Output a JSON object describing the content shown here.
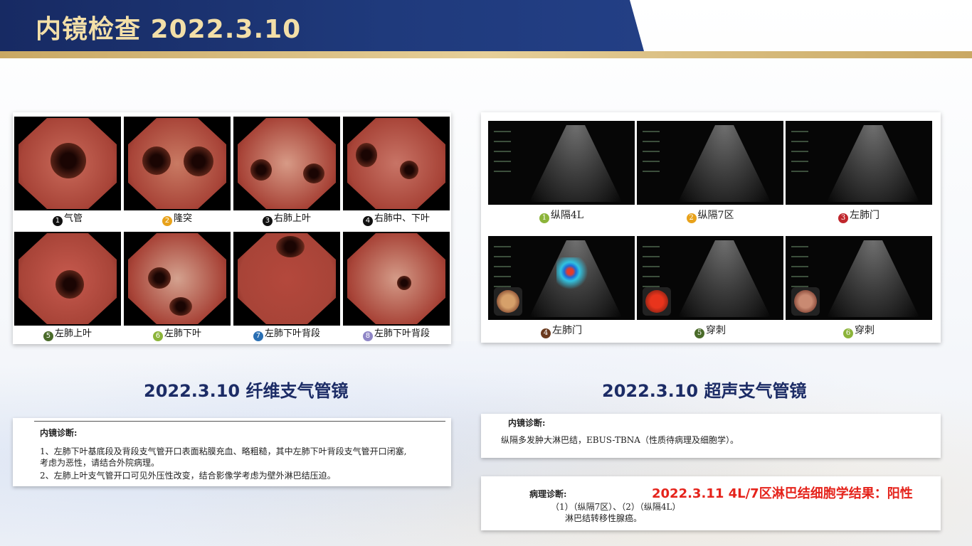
{
  "header": {
    "title": "内镜检查  2022.3.10"
  },
  "colors": {
    "header_blue": "#1f3a7c",
    "title_gold": "#f3dfa8",
    "result_red": "#e5231b",
    "caption_navy": "#1c2c66"
  },
  "bronchoscopy": {
    "caption": "2022.3.10 纤维支气管镜",
    "images": [
      {
        "num": "1",
        "label": "气管",
        "num_color": "#111111"
      },
      {
        "num": "2",
        "label": "隆突",
        "num_color": "#e8a21b"
      },
      {
        "num": "3",
        "label": "右肺上叶",
        "num_color": "#111111"
      },
      {
        "num": "4",
        "label": "右肺中、下叶",
        "num_color": "#111111"
      },
      {
        "num": "5",
        "label": "左肺上叶",
        "num_color": "#4a6b2a"
      },
      {
        "num": "6",
        "label": "左肺下叶",
        "num_color": "#8cb43a"
      },
      {
        "num": "7",
        "label": "左肺下叶背段",
        "num_color": "#2a6fb3"
      },
      {
        "num": "8",
        "label": "左肺下叶背段",
        "num_color": "#8f86c6"
      }
    ],
    "report": {
      "heading": "内镜诊断:",
      "lines": [
        "1、左肺下叶基底段及背段支气管开口表面粘膜充血、略粗糙，其中左肺下叶背段支气管开口闭塞,",
        "考虑为恶性，请结合外院病理。",
        "2、左肺上叶支气管开口可见外压性改变，结合影像学考虑为壁外淋巴结压迫。"
      ]
    }
  },
  "ebus": {
    "caption": "2022.3.10 超声支气管镜",
    "images": [
      {
        "num": "1",
        "label": "纵隔4L",
        "num_color": "#8cb43a"
      },
      {
        "num": "2",
        "label": "纵隔7区",
        "num_color": "#e8a21b"
      },
      {
        "num": "3",
        "label": "左肺门",
        "num_color": "#c0272d"
      },
      {
        "num": "4",
        "label": "左肺门",
        "num_color": "#6b3a1e"
      },
      {
        "num": "5",
        "label": "穿刺",
        "num_color": "#4a6b2a"
      },
      {
        "num": "6",
        "label": "穿刺",
        "num_color": "#8cb43a"
      }
    ],
    "report": {
      "heading": "内镜诊断:",
      "line": "纵隔多发肿大淋巴结，EBUS-TBNA（性质待病理及细胞学）。"
    },
    "pathology": {
      "heading": "病理诊断:",
      "line1": "（1）（纵隔7区）、（2）（纵隔4L）",
      "line2": "淋巴结转移性腺癌。",
      "result": "2022.3.11 4L/7区淋巴结细胞学结果：阳性"
    }
  }
}
